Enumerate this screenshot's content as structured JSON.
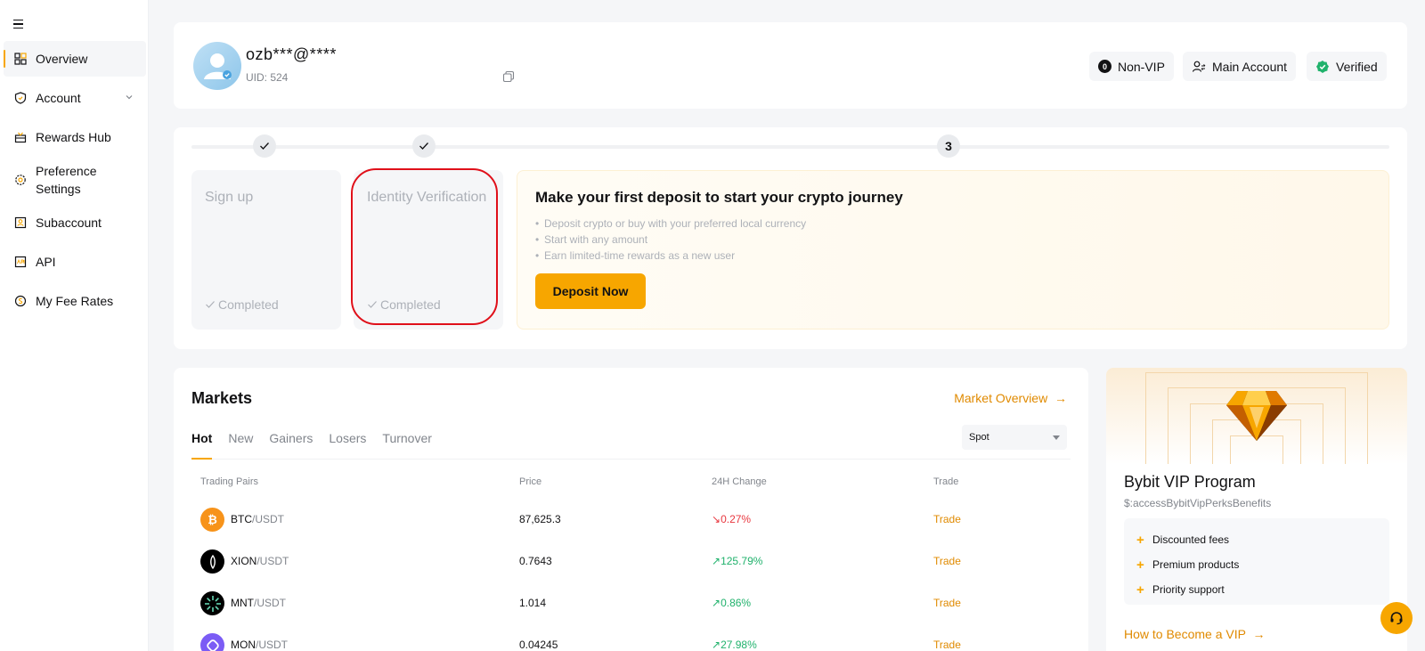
{
  "sidebar": {
    "items": [
      {
        "label": "Overview",
        "icon": "grid-icon",
        "active": true
      },
      {
        "label": "Account",
        "icon": "shield-icon"
      },
      {
        "label": "Rewards Hub",
        "icon": "gift-icon"
      },
      {
        "label": "Preference Settings",
        "icon": "gear-icon"
      },
      {
        "label": "Subaccount",
        "icon": "user-card-icon"
      },
      {
        "label": "API",
        "icon": "api-icon"
      },
      {
        "label": "My Fee Rates",
        "icon": "coin-icon"
      }
    ]
  },
  "profile": {
    "name": "ozb***@****",
    "uid": "UID: 524",
    "badges": {
      "vip_count": "0",
      "vip": "Non-VIP",
      "account": "Main Account",
      "verified": "Verified"
    }
  },
  "onboarding": {
    "step3_number": "3",
    "steps": [
      {
        "title": "Sign up",
        "status": "Completed"
      },
      {
        "title": "Identity Verification",
        "status": "Completed"
      }
    ],
    "deposit": {
      "title": "Make your first deposit to start your crypto journey",
      "bullets": [
        "Deposit crypto or buy with your preferred local currency",
        "Start with any amount",
        "Earn limited-time rewards as a new user"
      ],
      "button": "Deposit Now"
    }
  },
  "markets": {
    "title": "Markets",
    "overview_link": "Market Overview",
    "tabs": [
      "Hot",
      "New",
      "Gainers",
      "Losers",
      "Turnover"
    ],
    "select_value": "Spot",
    "columns": [
      "Trading Pairs",
      "Price",
      "24H Change",
      "Trade"
    ],
    "rows": [
      {
        "base": "BTC",
        "quote": "/USDT",
        "price": "87,625.3",
        "change": "0.27%",
        "direction": "down",
        "trade": "Trade",
        "color": "#f7931a"
      },
      {
        "base": "XION",
        "quote": "/USDT",
        "price": "0.7643",
        "change": "125.79%",
        "direction": "up",
        "trade": "Trade",
        "color": "#000000"
      },
      {
        "base": "MNT",
        "quote": "/USDT",
        "price": "1.014",
        "change": "0.86%",
        "direction": "up",
        "trade": "Trade",
        "color": "#000000"
      },
      {
        "base": "MON",
        "quote": "/USDT",
        "price": "0.04245",
        "change": "27.98%",
        "direction": "up",
        "trade": "Trade",
        "color": "#7b5cf5"
      }
    ]
  },
  "vip": {
    "title": "Bybit VIP Program",
    "subtitle": "$:accessBybitVipPerksBenefits",
    "perks": [
      "Discounted fees",
      "Premium products",
      "Priority support"
    ],
    "link": "How to Become a VIP"
  },
  "colors": {
    "accent": "#f7a600",
    "link": "#e08a00",
    "up": "#20b26c",
    "down": "#e8373f",
    "highlight": "#e0101a"
  }
}
